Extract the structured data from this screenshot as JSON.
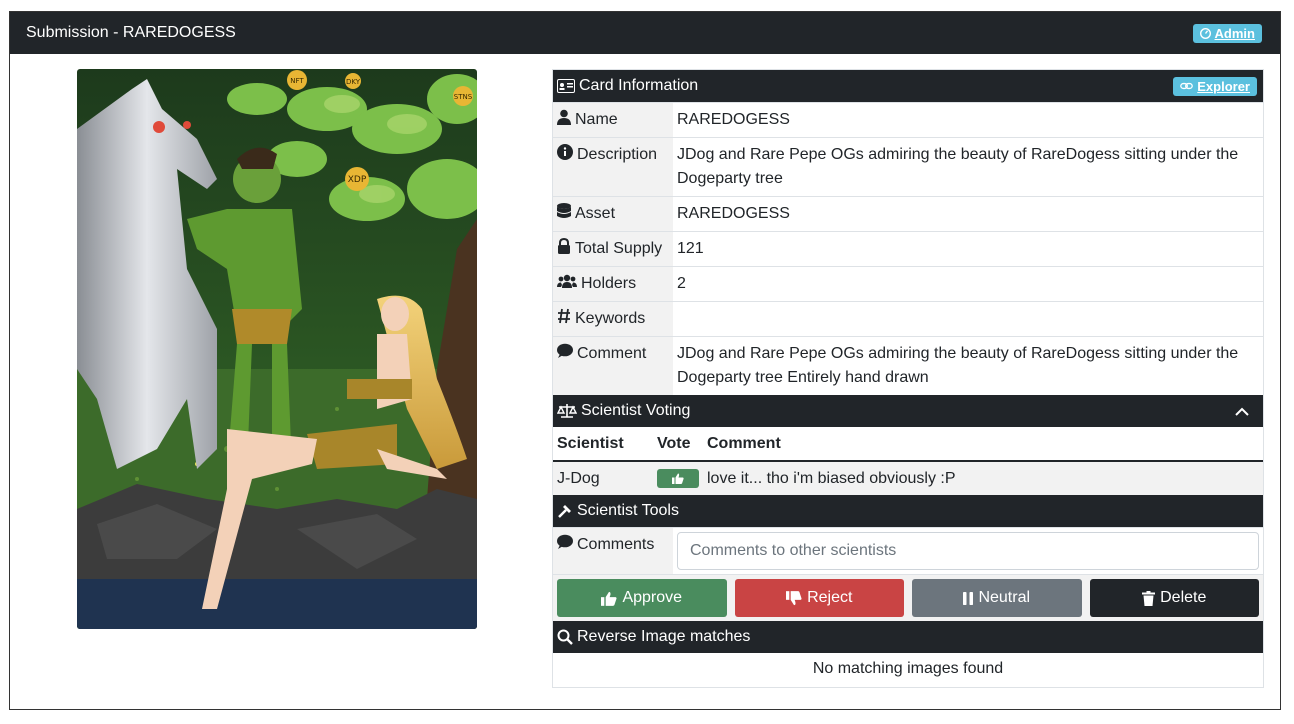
{
  "header": {
    "title": "Submission - RAREDOGESS",
    "admin_label": "Admin"
  },
  "artwork": {
    "coin_labels": [
      "NFT",
      "DKY",
      "XDP",
      "STNS"
    ]
  },
  "card_info": {
    "title": "Card Information",
    "explorer_label": "Explorer",
    "rows": [
      {
        "key": "Name",
        "value": "RAREDOGESS",
        "icon": "user-icon"
      },
      {
        "key": "Description",
        "value": "JDog and Rare Pepe OGs admiring the beauty of RareDogess sitting under the Dogeparty tree",
        "icon": "info-icon"
      },
      {
        "key": "Asset",
        "value": "RAREDOGESS",
        "icon": "database-icon"
      },
      {
        "key": "Total Supply",
        "value": "121",
        "icon": "lock-icon"
      },
      {
        "key": "Holders",
        "value": "2",
        "icon": "users-icon"
      },
      {
        "key": "Keywords",
        "value": "",
        "icon": "hash-icon"
      },
      {
        "key": "Comment",
        "value": "JDog and Rare Pepe OGs admiring the beauty of RareDogess sitting under the Dogeparty tree Entirely hand drawn",
        "icon": "comment-icon"
      }
    ]
  },
  "voting": {
    "title": "Scientist Voting",
    "columns": [
      "Scientist",
      "Vote",
      "Comment"
    ],
    "rows": [
      {
        "scientist": "J-Dog",
        "vote": "thumbs-up",
        "comment": "love it... tho i'm biased obviously :P"
      }
    ]
  },
  "tools": {
    "title": "Scientist Tools",
    "comments_label": "Comments",
    "comments_placeholder": "Comments to other scientists",
    "approve_label": "Approve",
    "reject_label": "Reject",
    "neutral_label": "Neutral",
    "delete_label": "Delete"
  },
  "reverse": {
    "title": "Reverse Image matches",
    "empty_text": "No matching images found"
  },
  "colors": {
    "dark": "#212529",
    "info": "#5bc0de",
    "approve": "#4a8c5e",
    "reject": "#c94444",
    "neutral": "#6c757d"
  }
}
